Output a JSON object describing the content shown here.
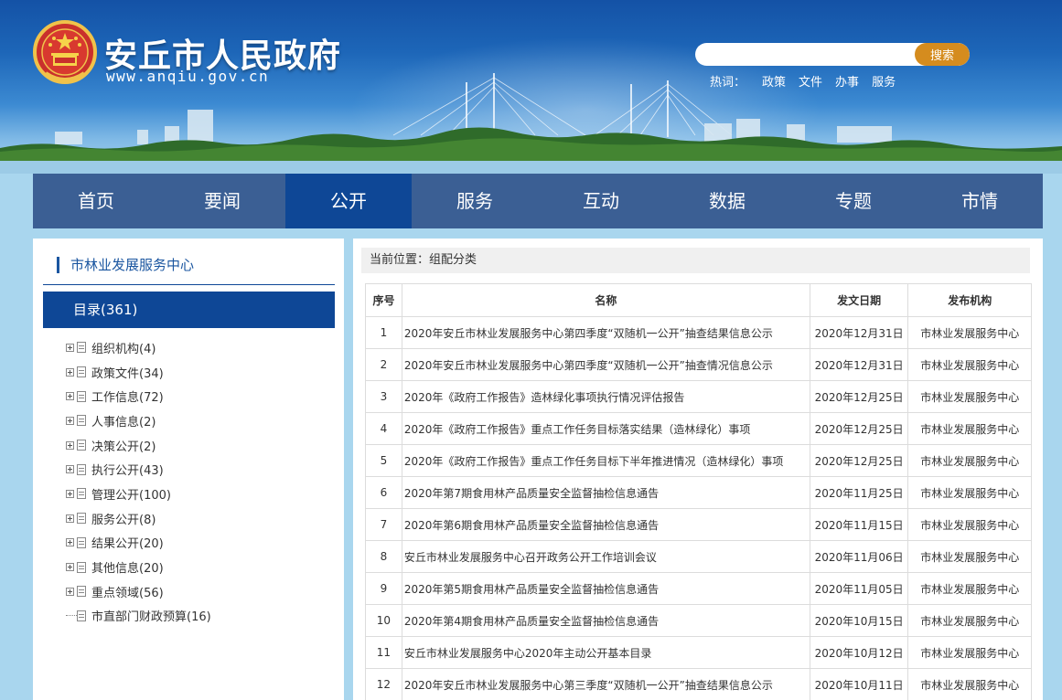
{
  "header": {
    "site_title": "安丘市人民政府",
    "site_url": "www.anqiu.gov.cn",
    "search": {
      "placeholder": "",
      "button_label": "搜索"
    },
    "hotwords_label": "热词：",
    "hotwords": [
      "政策",
      "文件",
      "办事",
      "服务"
    ]
  },
  "nav": {
    "items": [
      {
        "label": "首页"
      },
      {
        "label": "要闻"
      },
      {
        "label": "公开",
        "active": true
      },
      {
        "label": "服务"
      },
      {
        "label": "互动"
      },
      {
        "label": "数据"
      },
      {
        "label": "专题"
      },
      {
        "label": "市情"
      }
    ]
  },
  "sidebar": {
    "title": "市林业发展服务中心",
    "catalog_label": "目录(361)",
    "tree": [
      {
        "label": "组织机构(4)"
      },
      {
        "label": "政策文件(34)"
      },
      {
        "label": "工作信息(72)"
      },
      {
        "label": "人事信息(2)"
      },
      {
        "label": "决策公开(2)"
      },
      {
        "label": "执行公开(43)"
      },
      {
        "label": "管理公开(100)"
      },
      {
        "label": "服务公开(8)"
      },
      {
        "label": "结果公开(20)"
      },
      {
        "label": "其他信息(20)"
      },
      {
        "label": "重点领域(56)"
      },
      {
        "label": "市直部门财政预算(16)"
      }
    ]
  },
  "main": {
    "breadcrumb": "当前位置：组配分类",
    "table": {
      "headers": [
        "序号",
        "名称",
        "发文日期",
        "发布机构"
      ],
      "rows": [
        {
          "no": "1",
          "title": "2020年安丘市林业发展服务中心第四季度“双随机一公开”抽查结果信息公示",
          "date": "2020年12月31日",
          "org": "市林业发展服务中心"
        },
        {
          "no": "2",
          "title": "2020年安丘市林业发展服务中心第四季度“双随机一公开”抽查情况信息公示",
          "date": "2020年12月31日",
          "org": "市林业发展服务中心"
        },
        {
          "no": "3",
          "title": "2020年《政府工作报告》造林绿化事项执行情况评估报告",
          "date": "2020年12月25日",
          "org": "市林业发展服务中心"
        },
        {
          "no": "4",
          "title": "2020年《政府工作报告》重点工作任务目标落实结果（造林绿化）事项",
          "date": "2020年12月25日",
          "org": "市林业发展服务中心"
        },
        {
          "no": "5",
          "title": "2020年《政府工作报告》重点工作任务目标下半年推进情况（造林绿化）事项",
          "date": "2020年12月25日",
          "org": "市林业发展服务中心"
        },
        {
          "no": "6",
          "title": "2020年第7期食用林产品质量安全监督抽检信息通告",
          "date": "2020年11月25日",
          "org": "市林业发展服务中心"
        },
        {
          "no": "7",
          "title": "2020年第6期食用林产品质量安全监督抽检信息通告",
          "date": "2020年11月15日",
          "org": "市林业发展服务中心"
        },
        {
          "no": "8",
          "title": "安丘市林业发展服务中心召开政务公开工作培训会议",
          "date": "2020年11月06日",
          "org": "市林业发展服务中心"
        },
        {
          "no": "9",
          "title": "2020年第5期食用林产品质量安全监督抽检信息通告",
          "date": "2020年11月05日",
          "org": "市林业发展服务中心"
        },
        {
          "no": "10",
          "title": "2020年第4期食用林产品质量安全监督抽检信息通告",
          "date": "2020年10月15日",
          "org": "市林业发展服务中心"
        },
        {
          "no": "11",
          "title": "安丘市林业发展服务中心2020年主动公开基本目录",
          "date": "2020年10月12日",
          "org": "市林业发展服务中心"
        },
        {
          "no": "12",
          "title": "2020年安丘市林业发展服务中心第三季度“双随机一公开”抽查结果信息公示",
          "date": "2020年10月11日",
          "org": "市林业发展服务中心"
        }
      ]
    }
  },
  "colors": {
    "nav_bg": "#3b5f94",
    "nav_active": "#0e4796",
    "search_button": "#d58c1e",
    "sidebar_accent": "#1b56a0",
    "page_bg": "#a9d6ee"
  },
  "icons": {
    "emblem": "national-emblem-icon",
    "tree_expand": "plus-box-icon",
    "tree_doc": "document-icon"
  }
}
